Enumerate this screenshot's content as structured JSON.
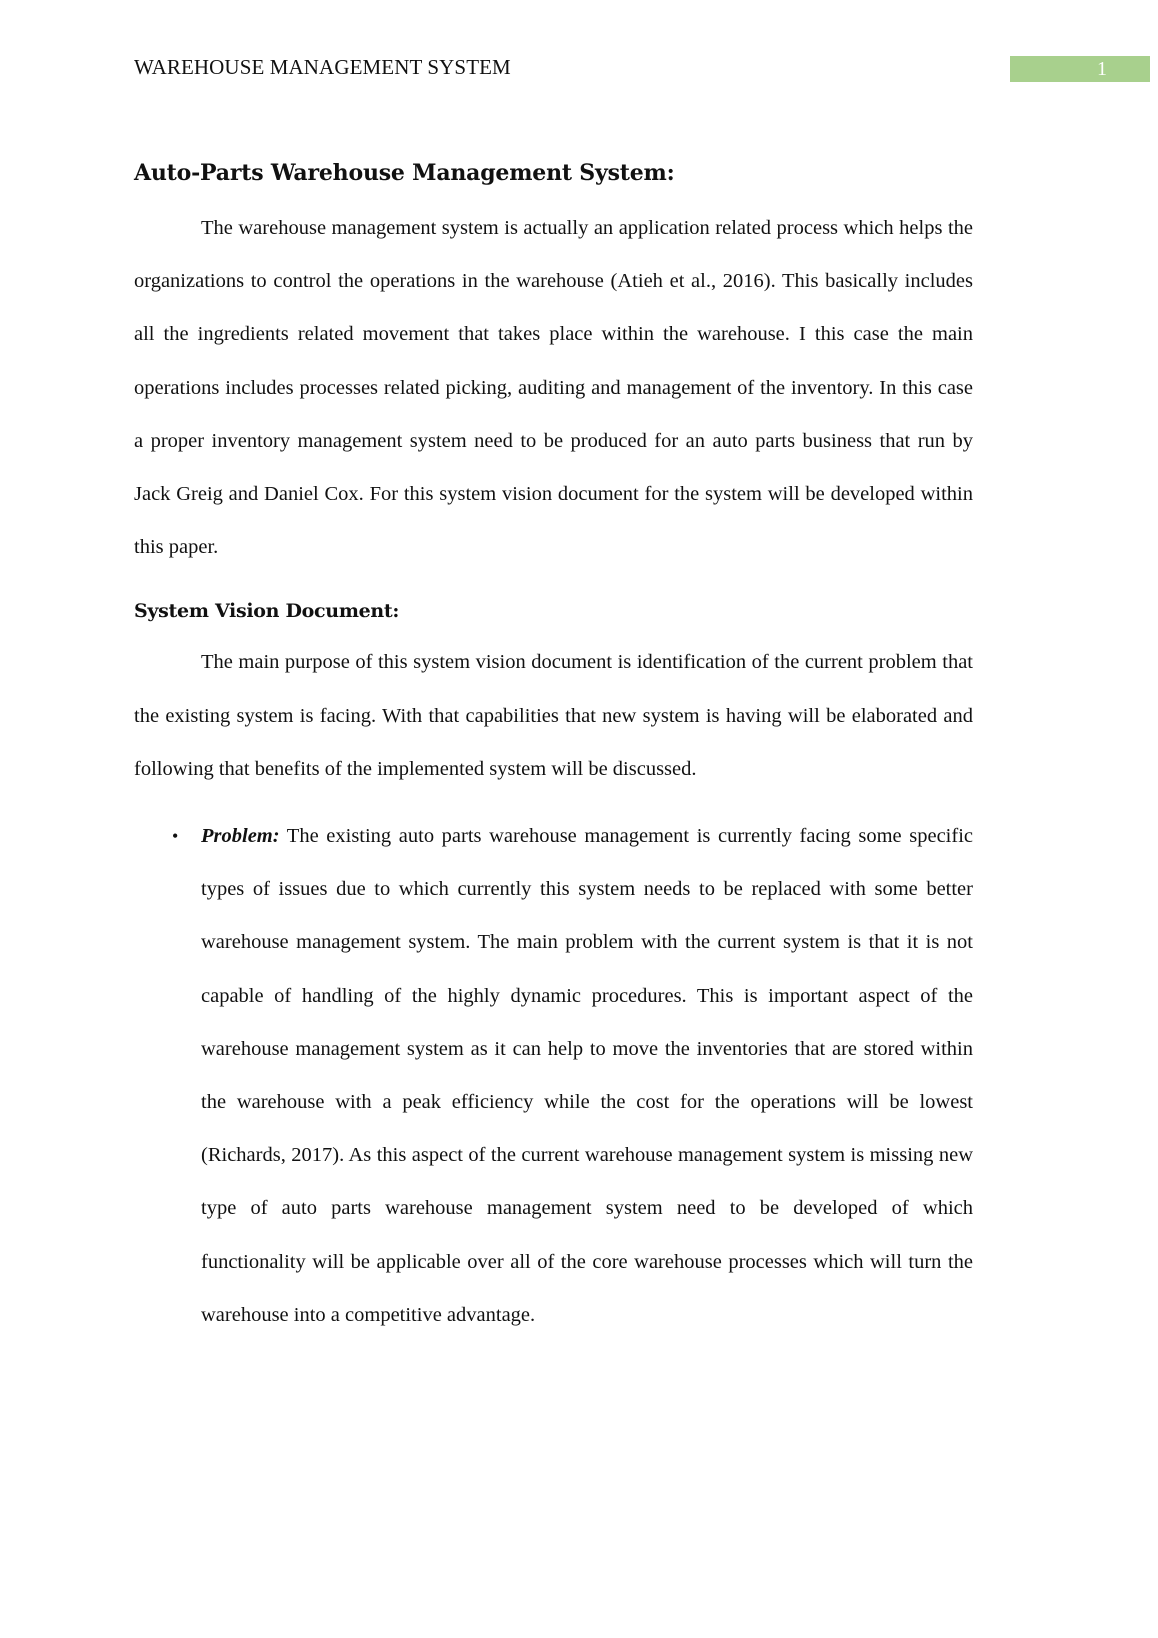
{
  "header": {
    "running_head": "WAREHOUSE MANAGEMENT SYSTEM",
    "page_number": "1",
    "page_number_box_color": "#a8d08d"
  },
  "document": {
    "title": "Auto-Parts Warehouse Management System:",
    "intro_paragraph": "The warehouse management system is actually an application related process which helps the organizations to control the operations in the warehouse (Atieh et al., 2016). This basically includes all the ingredients related movement that takes place within the warehouse. I this case the main operations includes processes related picking, auditing and management of the inventory. In this case a proper inventory management system need to be produced for an auto parts business that run by Jack Greig and Daniel Cox. For this system vision document for the system will be developed within this paper.",
    "section": {
      "heading": "System Vision Document:",
      "paragraph": "The main purpose of this system vision document is identification of the current problem that the existing system is facing. With that capabilities that new system is having will be elaborated and following that benefits of the implemented system will be discussed.",
      "bullets": [
        {
          "symbol": "•",
          "label": "Problem:",
          "text": " The existing auto parts warehouse management is currently facing some specific types of issues due to which currently this system needs to be replaced with some better warehouse management system. The main problem with the current system is that it is not capable of handling of the highly dynamic procedures. This is important aspect of the warehouse management system as it can help to move the inventories that are stored within the warehouse with a peak efficiency while the cost for the operations will be lowest (Richards, 2017). As this aspect of the current warehouse management system is missing new type of auto parts warehouse management system need to be developed of which functionality will be applicable over all of the core warehouse processes which will turn the warehouse into a competitive advantage."
        }
      ]
    }
  }
}
